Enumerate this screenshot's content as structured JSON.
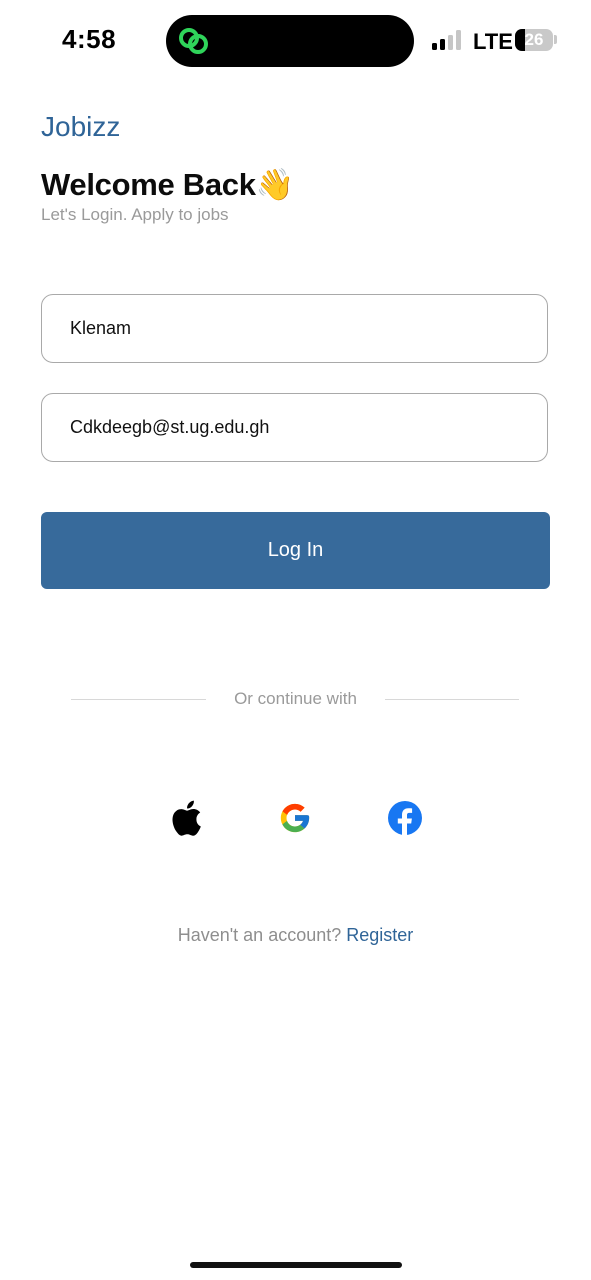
{
  "status_bar": {
    "time": "4:58",
    "network": "LTE",
    "battery_level": "26",
    "battery_fraction": 0.26,
    "signal_bars_active": 2,
    "signal_bars_total": 4,
    "island_icon": "link-rings-icon",
    "island_icon_color": "#2fd45a"
  },
  "header": {
    "brand": "Jobizz",
    "title": "Welcome Back👋",
    "subtitle": "Let's Login. Apply to jobs"
  },
  "form": {
    "username_value": "Klenam",
    "email_value": "Cdkdeegb@st.ug.edu.gh",
    "login_label": "Log In"
  },
  "divider": {
    "text": "Or continue with"
  },
  "social": [
    {
      "name": "apple",
      "icon": "apple-icon"
    },
    {
      "name": "google",
      "icon": "google-icon"
    },
    {
      "name": "facebook",
      "icon": "facebook-icon"
    }
  ],
  "footer": {
    "prompt": "Haven't an account?",
    "register_label": "Register"
  },
  "colors": {
    "brand": "#2f6497",
    "button": "#376a9b",
    "muted_text": "#9a9a9a",
    "field_border": "#a9a9a9",
    "facebook": "#1877f2"
  }
}
